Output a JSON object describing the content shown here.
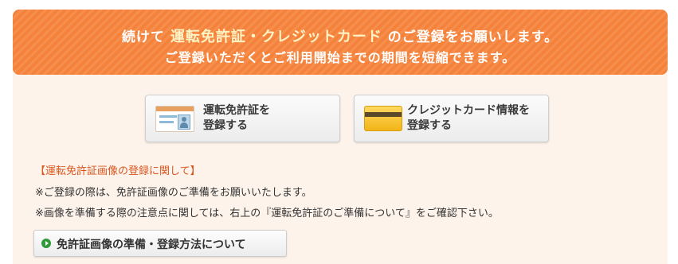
{
  "banner": {
    "line1_prefix": "続けて",
    "line1_highlight": "運転免許証・クレジットカード",
    "line1_suffix": "のご登録をお願いします。",
    "line2": "ご登録いただくとご利用開始までの期間を短縮できます。"
  },
  "buttons": {
    "license": {
      "line1": "運転免許証を",
      "line2": "登録する",
      "icon": "license-card-icon"
    },
    "credit_card": {
      "line1": "クレジットカード情報を",
      "line2": "登録する",
      "icon": "credit-card-icon"
    }
  },
  "notes": {
    "title": "【運転免許証画像の登録に関して】",
    "line1": "※ご登録の際は、免許証画像のご準備をお願いいたします。",
    "line2": "※画像を準備する際の注意点に関しては、右上の『運転免許証のご準備について』をご確認下さい。"
  },
  "howto": {
    "label": "免許証画像の準備・登録方法について",
    "icon": "green-arrow-circle-icon"
  },
  "colors": {
    "banner": "#f5823a",
    "panel": "#fdf3ea",
    "highlight": "#fff3c4",
    "note_title": "#d9561f",
    "howto_icon": "#2e9a3a"
  }
}
